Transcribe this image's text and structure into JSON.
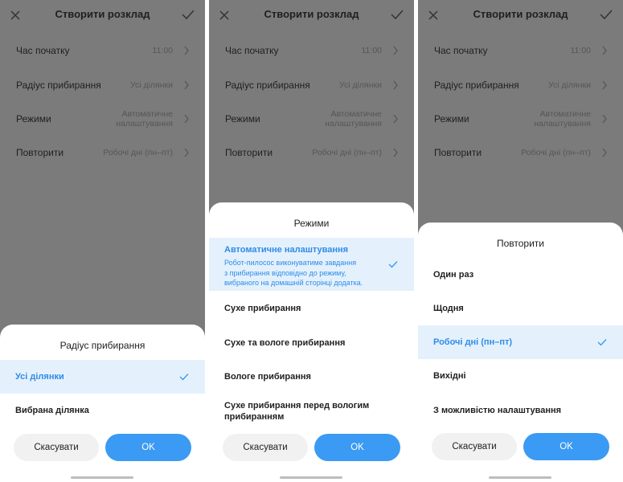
{
  "screen": {
    "title": "Створити розклад",
    "rows": [
      {
        "label": "Час початку",
        "value": "11:00"
      },
      {
        "label": "Радіус прибирання",
        "value": "Усі ділянки"
      },
      {
        "label": "Режими",
        "value_line1": "Автоматичне",
        "value_line2": "налаштування"
      },
      {
        "label": "Повторити",
        "value": "Робочі дні (пн–пт)"
      }
    ]
  },
  "panel1": {
    "sheet_title": "Радіус прибирання",
    "options": [
      "Усі ділянки",
      "Вибрана ділянка"
    ],
    "selected": "Усі ділянки"
  },
  "panel2": {
    "sheet_title": "Режими",
    "options": [
      {
        "label": "Автоматичне налаштування",
        "desc1": "Робот-пилосос виконуватиме завдання",
        "desc2": "з прибирання відповідно до режиму,",
        "desc3": "вибраного на домашній сторінці додатка."
      },
      {
        "label": "Сухе прибирання"
      },
      {
        "label": "Сухе та вологе прибирання"
      },
      {
        "label": "Вологе прибирання"
      },
      {
        "label_line1": "Сухе прибирання перед вологим",
        "label_line2": "прибиранням"
      }
    ],
    "selected": "Автоматичне налаштування"
  },
  "panel3": {
    "sheet_title": "Повторити",
    "options": [
      "Один раз",
      "Щодня",
      "Робочі дні (пн–пт)",
      "Вихідні",
      "З можливістю налаштування"
    ],
    "selected": "Робочі дні (пн–пт)"
  },
  "buttons": {
    "cancel": "Скасувати",
    "ok": "OK"
  },
  "colors": {
    "accent": "#3b9af3",
    "selected_bg": "#e4f1fd",
    "overlay": "#7b7b7b"
  }
}
